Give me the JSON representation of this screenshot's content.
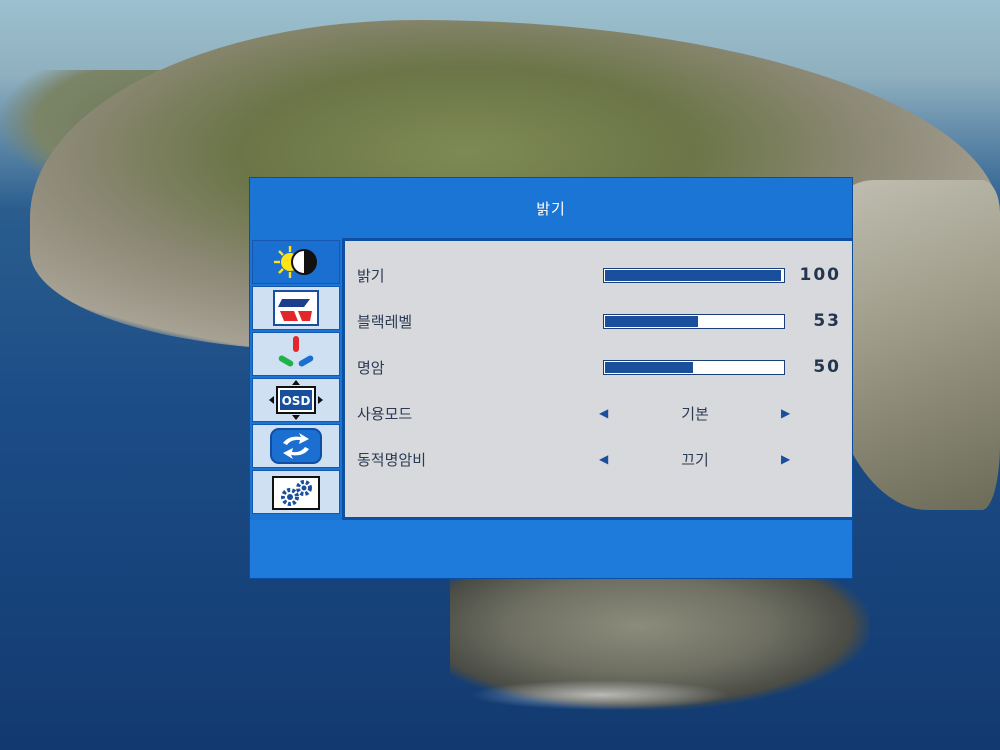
{
  "osd": {
    "title": "밝기",
    "menu_icons": [
      "brightness-contrast-icon",
      "color-setting-icon",
      "rgb-color-icon",
      "osd-position-icon",
      "reset-icon",
      "settings-gears-icon"
    ],
    "active_menu": "brightness-contrast-icon",
    "osd_icon_text": "OSD",
    "settings": {
      "brightness": {
        "label": "밝기",
        "value": "100",
        "level": 100
      },
      "black_level": {
        "label": "블랙레벨",
        "value": "53",
        "level": 53
      },
      "contrast": {
        "label": "명암",
        "value": "50",
        "level": 50
      },
      "use_mode": {
        "label": "사용모드",
        "value": "기본"
      },
      "dcr": {
        "label": "동적명암비",
        "value": "끄기"
      }
    },
    "arrow_left": "◀",
    "arrow_right": "▶"
  },
  "colors": {
    "frame": "#1b75d4",
    "panel": "#d8d9dc",
    "bar": "#1a4f9e",
    "border": "#0f4fa3"
  }
}
